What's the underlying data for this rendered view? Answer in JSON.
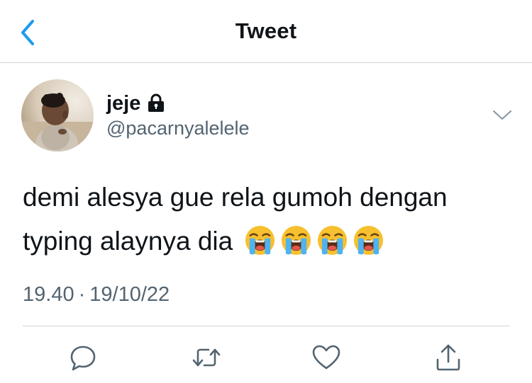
{
  "header": {
    "title": "Tweet",
    "back_icon": "chevron-left-icon"
  },
  "tweet": {
    "author": {
      "name": "jeje",
      "handle": "@pacarnyalelele",
      "protected_icon": "lock-icon"
    },
    "text": "demi alesya gue rela gumoh dengan typing alaynya dia",
    "emojis": [
      "loudly-crying-face",
      "loudly-crying-face",
      "loudly-crying-face",
      "loudly-crying-face"
    ],
    "time": "19.40",
    "separator": "·",
    "date": "19/10/22"
  },
  "actions": {
    "icons": [
      "reply-icon",
      "retweet-icon",
      "like-icon",
      "share-icon"
    ]
  },
  "colors": {
    "accent": "#1d9bf0",
    "text_primary": "#0f1419",
    "text_secondary": "#536471",
    "divider": "#cfd4d8"
  }
}
